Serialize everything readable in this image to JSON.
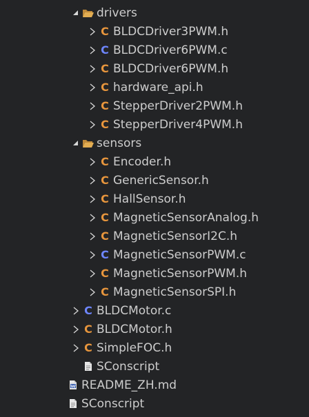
{
  "tree": {
    "drivers": {
      "label": "drivers",
      "children": [
        {
          "label": "BLDCDriver3PWM.h",
          "kind": "c-header"
        },
        {
          "label": "BLDCDriver6PWM.c",
          "kind": "c-source"
        },
        {
          "label": "BLDCDriver6PWM.h",
          "kind": "c-header"
        },
        {
          "label": "hardware_api.h",
          "kind": "c-header"
        },
        {
          "label": "StepperDriver2PWM.h",
          "kind": "c-header"
        },
        {
          "label": "StepperDriver4PWM.h",
          "kind": "c-header"
        }
      ]
    },
    "sensors": {
      "label": "sensors",
      "children": [
        {
          "label": "Encoder.h",
          "kind": "c-header"
        },
        {
          "label": "GenericSensor.h",
          "kind": "c-header"
        },
        {
          "label": "HallSensor.h",
          "kind": "c-header"
        },
        {
          "label": "MagneticSensorAnalog.h",
          "kind": "c-header"
        },
        {
          "label": "MagneticSensorI2C.h",
          "kind": "c-header"
        },
        {
          "label": "MagneticSensorPWM.c",
          "kind": "c-source"
        },
        {
          "label": "MagneticSensorPWM.h",
          "kind": "c-header"
        },
        {
          "label": "MagneticSensorSPI.h",
          "kind": "c-header"
        }
      ]
    },
    "root_files": [
      {
        "label": "BLDCMotor.c",
        "kind": "c-source"
      },
      {
        "label": "BLDCMotor.h",
        "kind": "c-header"
      },
      {
        "label": "SimpleFOC.h",
        "kind": "c-header"
      },
      {
        "label": "SConscript",
        "kind": "doc"
      }
    ],
    "top_files": [
      {
        "label": "README_ZH.md",
        "kind": "markdown"
      },
      {
        "label": "SConscript",
        "kind": "doc"
      }
    ]
  },
  "icons": {
    "c_letter": "C",
    "expanded_twisty": "chevron-expanded-icon",
    "collapsed_twisty": "chevron-collapsed-icon",
    "folder_open": "folder-open-icon",
    "doc": "document-icon",
    "markdown": "word-document-icon"
  },
  "colors": {
    "background": "#232426",
    "text": "#cdcdcd",
    "c_header": "#e8963d",
    "c_source": "#6e86ff",
    "folder": "#d9a24a"
  }
}
